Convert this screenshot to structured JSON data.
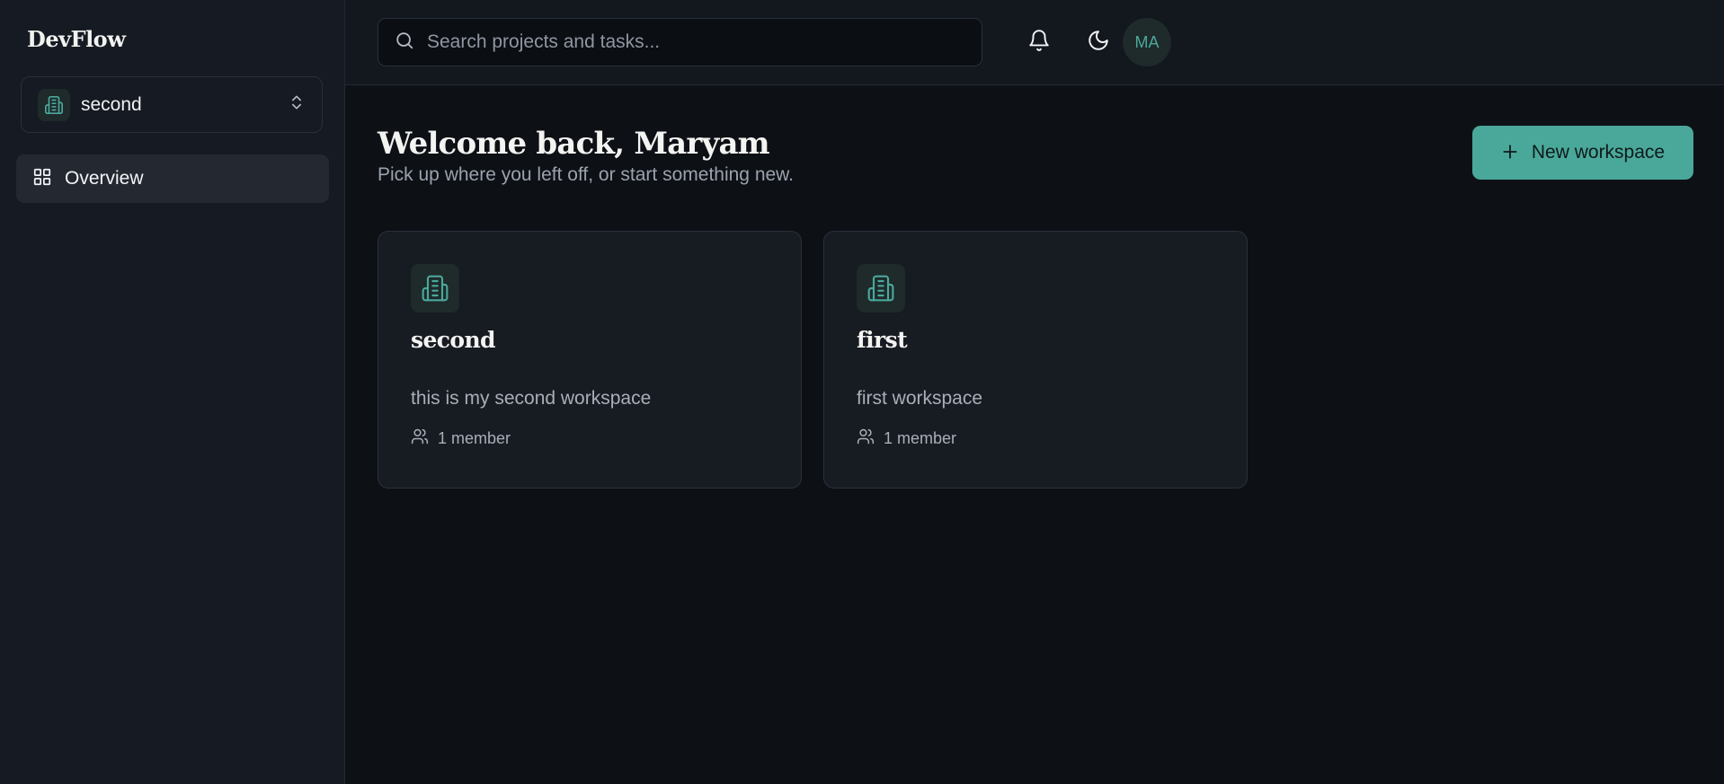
{
  "sidebar": {
    "brand": "DevFlow",
    "workspace_switcher": {
      "current": "second"
    },
    "nav": [
      {
        "label": "Overview"
      }
    ]
  },
  "topbar": {
    "search_placeholder": "Search projects and tasks...",
    "avatar_initials": "MA"
  },
  "main": {
    "title": "Welcome back, Maryam",
    "subtitle": "Pick up where you left off, or start something new.",
    "new_workspace_label": "New workspace",
    "workspaces": [
      {
        "name": "second",
        "description": "this is my second workspace",
        "members": "1 member"
      },
      {
        "name": "first",
        "description": "first workspace",
        "members": "1 member"
      }
    ]
  },
  "icons": {
    "workspace": "building-icon",
    "chevron": "chevron-up-down-icon",
    "overview": "grid-icon",
    "search": "search-icon",
    "bell": "bell-icon",
    "theme": "moon-icon",
    "members": "users-icon",
    "plus": "plus-icon"
  },
  "colors": {
    "accent": "#4aa89a",
    "background": "#0d1015",
    "sidebar": "#161a22",
    "card": "#171b22"
  }
}
